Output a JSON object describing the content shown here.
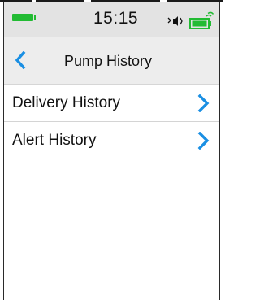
{
  "status_bar": {
    "time": "15:15",
    "pump_battery_color": "#22bb33",
    "phone_battery_color": "#22bb33",
    "icons": [
      "pump-battery-icon",
      "bluetooth-sound-icon",
      "phone-battery-icon"
    ]
  },
  "header": {
    "title": "Pump History",
    "back_icon": "chevron-left-icon"
  },
  "menu": {
    "items": [
      {
        "label": "Delivery History",
        "icon": "chevron-right-icon"
      },
      {
        "label": "Alert History",
        "icon": "chevron-right-icon"
      }
    ]
  },
  "colors": {
    "accent": "#1a8fe3",
    "status_bar_bg": "#e3e3e3",
    "header_bg": "#ededed"
  }
}
